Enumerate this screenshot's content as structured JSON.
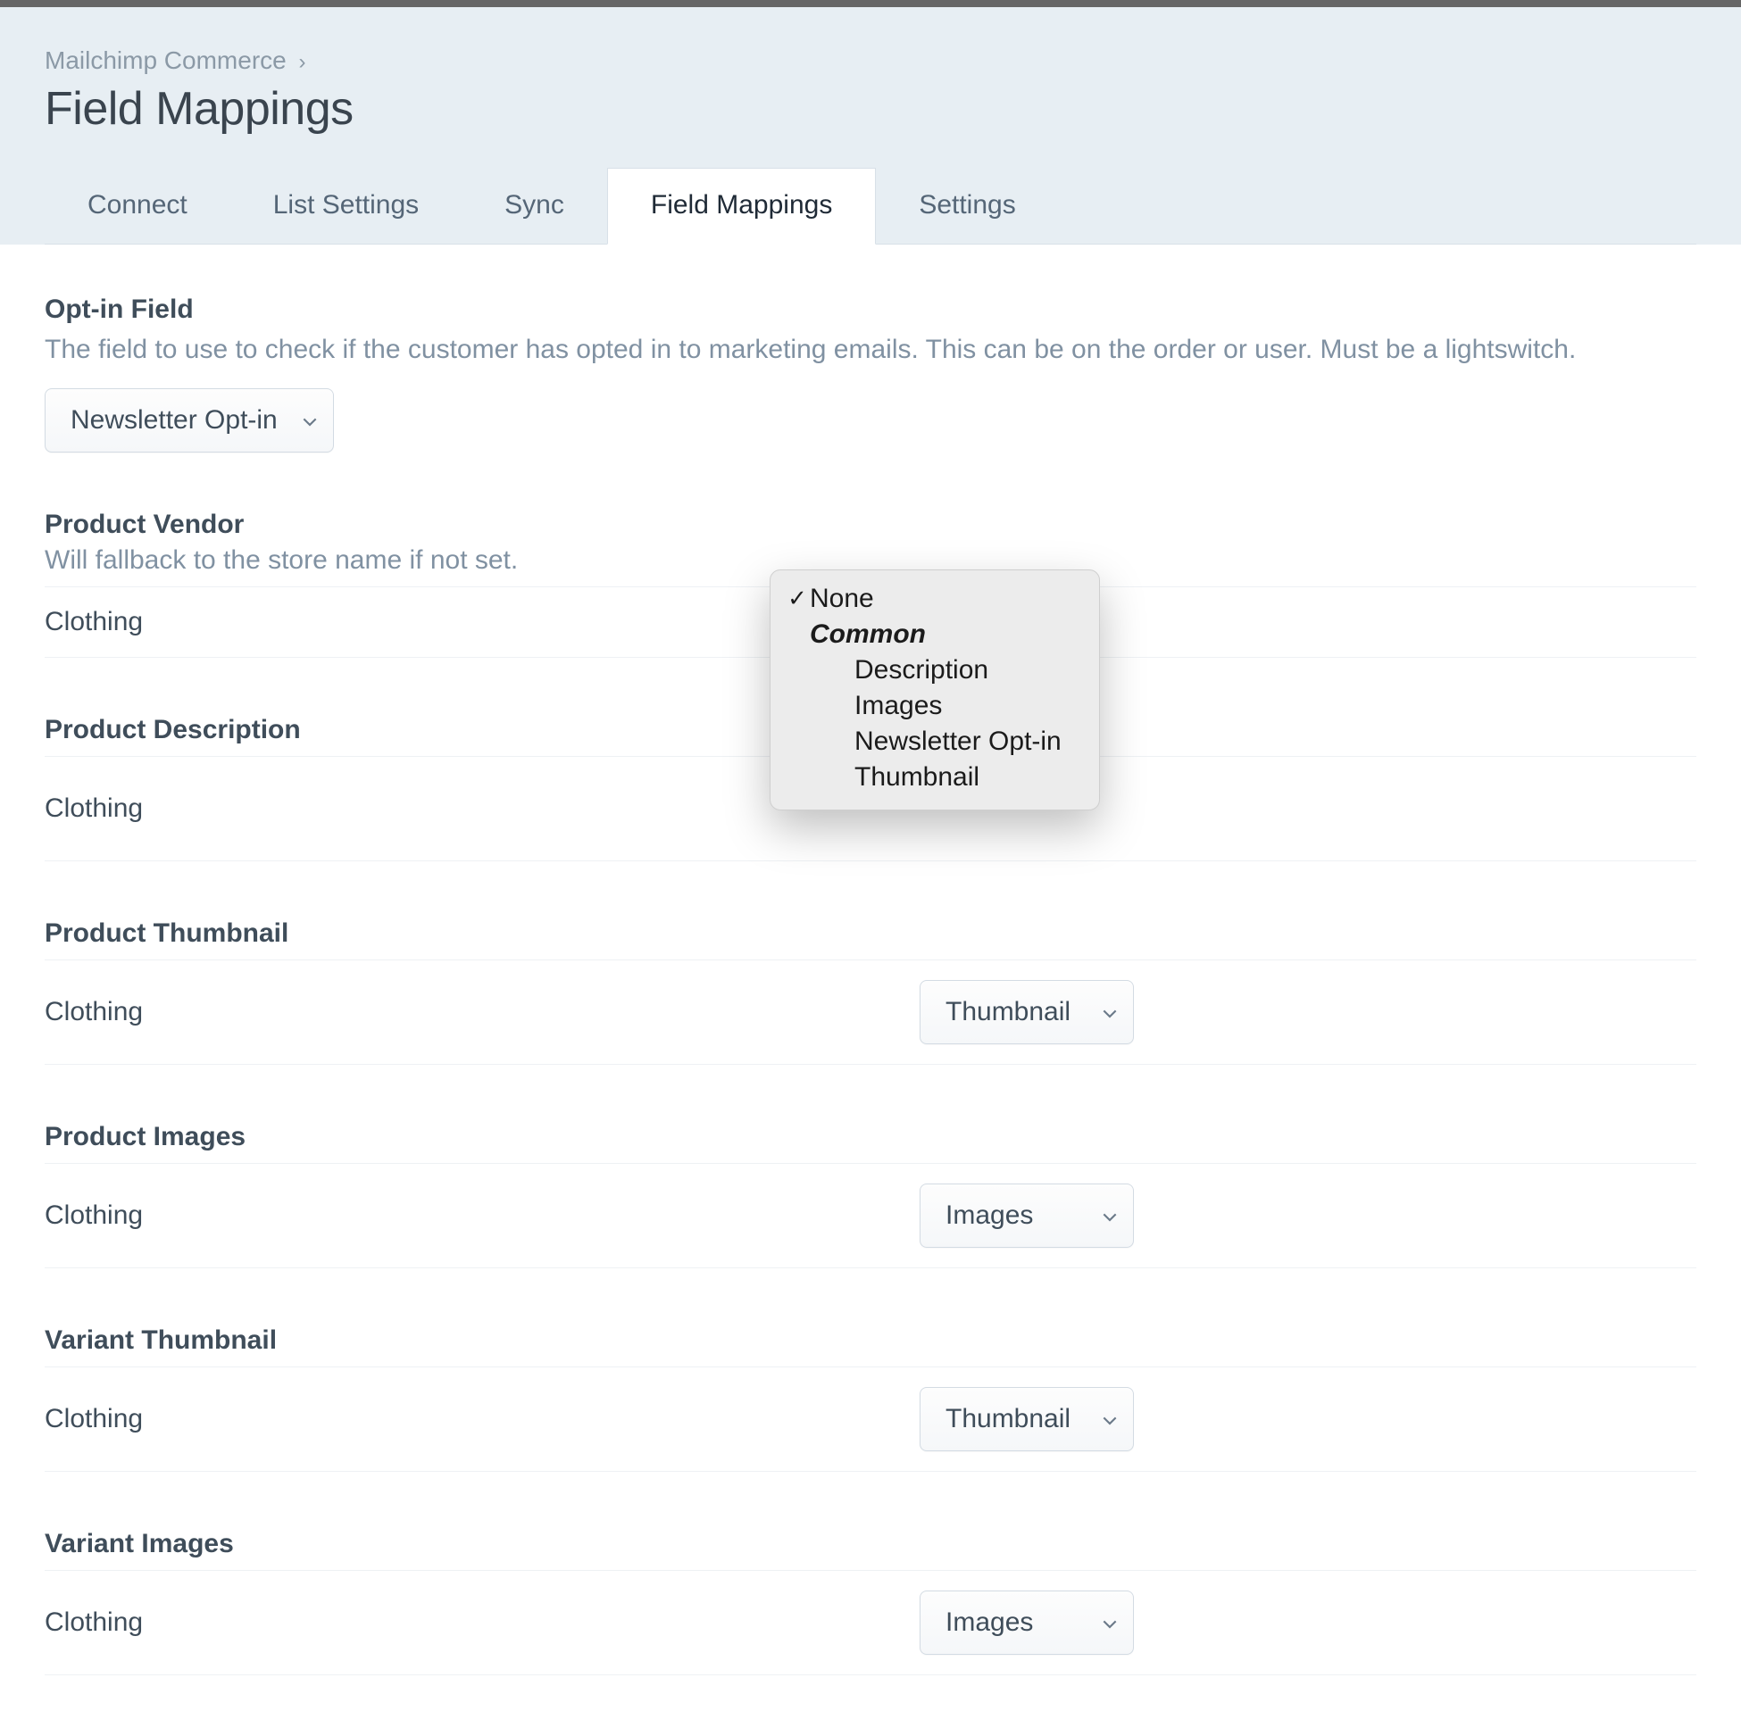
{
  "breadcrumb": {
    "parent": "Mailchimp Commerce",
    "sep": "›"
  },
  "page_title": "Field Mappings",
  "tabs": {
    "connect": "Connect",
    "list_settings": "List Settings",
    "sync": "Sync",
    "field_mappings": "Field Mappings",
    "settings": "Settings"
  },
  "optin": {
    "title": "Opt-in Field",
    "desc": "The field to use to check if the customer has opted in to marketing emails. This can be on the order or user. Must be a lightswitch.",
    "value": "Newsletter Opt-in"
  },
  "vendor": {
    "title": "Product Vendor",
    "desc": "Will fallback to the store name if not set.",
    "row_label": "Clothing"
  },
  "description_map": {
    "title": "Product Description",
    "row_label": "Clothing"
  },
  "thumbnail_map": {
    "title": "Product Thumbnail",
    "row_label": "Clothing",
    "value": "Thumbnail"
  },
  "images_map": {
    "title": "Product Images",
    "row_label": "Clothing",
    "value": "Images"
  },
  "variant_thumb": {
    "title": "Variant Thumbnail",
    "row_label": "Clothing",
    "value": "Thumbnail"
  },
  "variant_images": {
    "title": "Variant Images",
    "row_label": "Clothing",
    "value": "Images"
  },
  "dropdown": {
    "none": "None",
    "group": "Common",
    "opt_description": "Description",
    "opt_images": "Images",
    "opt_newsletter": "Newsletter Opt-in",
    "opt_thumbnail": "Thumbnail",
    "selected": "None"
  }
}
